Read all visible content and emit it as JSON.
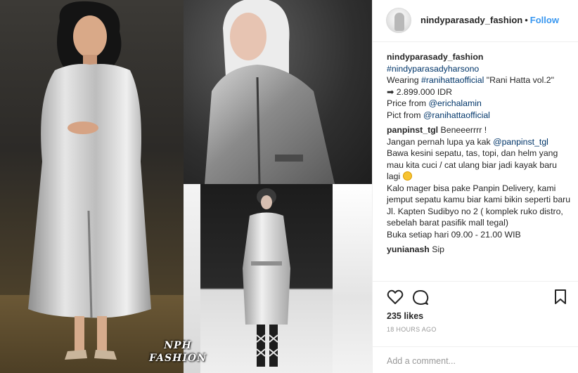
{
  "post": {
    "username": "nindyparasady_fashion",
    "separator": "•",
    "follow_label": "Follow"
  },
  "collage": {
    "watermark_line1": "NPH",
    "watermark_line2": "FASHION"
  },
  "caption": {
    "username": "nindyparasady_fashion",
    "hashtag": "#nindyparasadyharsono",
    "wearing_prefix": "Wearing ",
    "wearing_tag": "#ranihattaofficial",
    "wearing_suffix": " \"Rani Hatta vol.2\"",
    "price": "➡ 2.899.000 IDR",
    "price_from_prefix": "Price from ",
    "price_from_tag": "@erichalamin",
    "pict_from_prefix": "Pict from ",
    "pict_from_tag": "@ranihattaofficial"
  },
  "comment_1": {
    "username": "panpinst_tgl",
    "text": " Beneeerrrr !",
    "line2_prefix": "Jangan pernah lupa ya kak ",
    "line2_tag": "@panpinst_tgl",
    "line3": "Bawa kesini sepatu, tas, topi, dan helm yang mau kita cuci / cat ulang biar jadi kayak baru lagi ",
    "line4": "Kalo mager bisa pake Panpin Delivery, kami jemput sepatu kamu biar kami bikin seperti baru",
    "line5": "Jl. Kapten Sudibyo no 2 ( komplek ruko distro, sebelah barat pasifik mall tegal)",
    "line6": "Buka setiap hari 09.00 - 21.00 WIB"
  },
  "comment_2": {
    "username": "yunianash",
    "text": " Sip"
  },
  "stats": {
    "likes": "235 likes",
    "age": "18 HOURS AGO"
  },
  "add_comment": {
    "placeholder": "Add a comment..."
  },
  "icons": {
    "heart": "heart-icon",
    "comment": "comment-icon",
    "bookmark": "bookmark-icon"
  },
  "colors": {
    "link_blue": "#3897f0",
    "tag_navy": "#003569",
    "text": "#262626",
    "muted": "#999999"
  }
}
